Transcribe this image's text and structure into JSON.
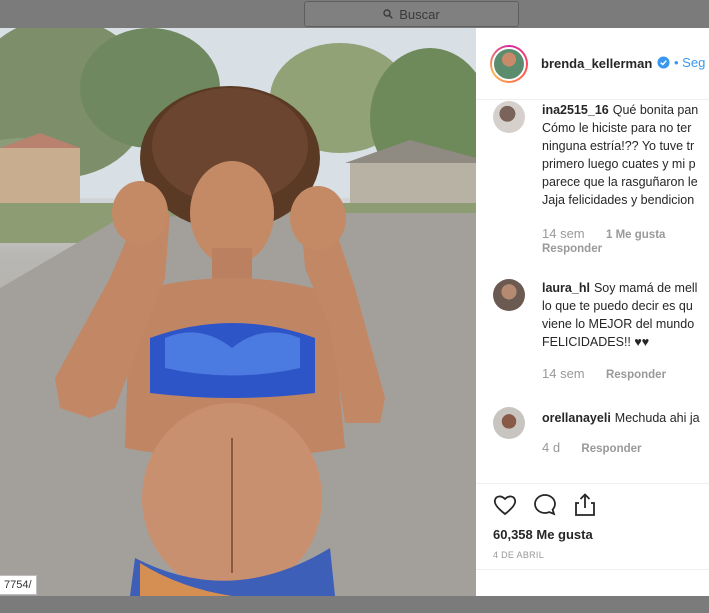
{
  "search": {
    "placeholder": "Buscar"
  },
  "photo": {
    "url_fragment": "7754/"
  },
  "post": {
    "username": "brenda_kellerman",
    "follow_label": "Seg",
    "verified": true,
    "likes": "60,358 Me gusta",
    "date": "4 DE ABRIL"
  },
  "comments": [
    {
      "user": "ina2515_16",
      "lines": [
        "Qué bonita pan",
        "Cómo le hiciste para no ter",
        "ninguna estría!?? Yo tuve tr",
        "primero luego cuates y mi p",
        "parece que la rasguñaron le",
        "Jaja felicidades y bendicion"
      ],
      "time": "14 sem",
      "likes": "1 Me gusta",
      "reply": "Responder"
    },
    {
      "user": "laura_hl",
      "lines": [
        "Soy mamá de mell",
        "lo que te puedo decir es qu",
        "viene lo MEJOR del mundo",
        "FELICIDADES!! ♥♥"
      ],
      "time": "14 sem",
      "likes": "",
      "reply": "Responder"
    },
    {
      "user": "orellanayeli",
      "lines": [
        "Mechuda ahi ja"
      ],
      "time": "4 d",
      "likes": "",
      "reply": "Responder"
    }
  ],
  "icons": [
    "search-icon",
    "verified-icon",
    "heart-icon",
    "comment-icon",
    "share-icon"
  ],
  "colors": {
    "link": "#3897f0",
    "verified": "#3897f0",
    "muted": "#999999"
  }
}
